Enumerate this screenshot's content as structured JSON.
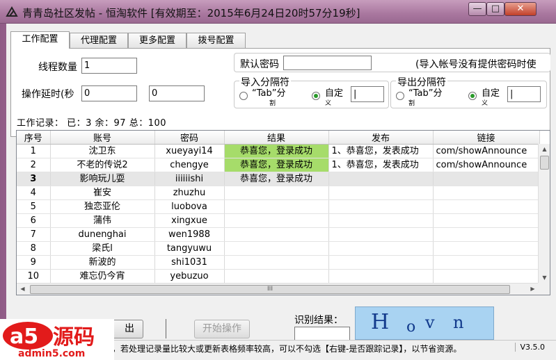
{
  "window": {
    "title": "青青岛社区发帖 - 恒淘软件 [有效期至：2015年6月24日20时57分19秒]",
    "controls": {
      "minimize": "—",
      "maximize": "□",
      "close": "✕"
    }
  },
  "tabs": [
    "工作配置",
    "代理配置",
    "更多配置",
    "拨号配置"
  ],
  "config": {
    "thread_count_label": "线程数量",
    "thread_count_value": "1",
    "delay_label": "操作延时(秒",
    "delay_from": "0",
    "delay_to": "0",
    "default_password_label": "默认密码",
    "default_password_value": "",
    "default_password_hint": "(导入帐号没有提供密码时使",
    "import_sep": {
      "title": "导入分隔符",
      "option_tab": "“Tab”分",
      "option_tab_sub": "割",
      "option_custom": "自定",
      "option_custom_sub": "义",
      "custom_value": "|",
      "selected": "custom"
    },
    "export_sep": {
      "title": "导出分隔符",
      "option_tab": "“Tab”分",
      "option_tab_sub": "割",
      "option_custom": "自定",
      "option_custom_sub": "义",
      "custom_value": "|",
      "selected": "custom"
    }
  },
  "work_record": "工作记录：  已：3  余：97  总：100",
  "grid": {
    "columns": [
      "序号",
      "账号",
      "密码",
      "结果",
      "发布",
      "链接"
    ],
    "rows": [
      {
        "no": "1",
        "account": "沈卫东",
        "password": "xueyayi14",
        "result": "恭喜您，登录成功",
        "publish": "1、恭喜您，发表成功",
        "link": "com/showAnnounce"
      },
      {
        "no": "2",
        "account": "不老的传说2",
        "password": "chengye",
        "result": "恭喜您，登录成功",
        "publish": "1、恭喜您，发表成功",
        "link": "com/showAnnounce"
      },
      {
        "no": "3",
        "account": "影响玩儿耍",
        "password": "iiiiiishi",
        "result": "恭喜您，登录成功",
        "publish": "",
        "link": ""
      },
      {
        "no": "4",
        "account": "崔安",
        "password": "zhuzhu",
        "result": "",
        "publish": "",
        "link": ""
      },
      {
        "no": "5",
        "account": "独恋亚伦",
        "password": "luobova",
        "result": "",
        "publish": "",
        "link": ""
      },
      {
        "no": "6",
        "account": "蒲伟",
        "password": "xingxue",
        "result": "",
        "publish": "",
        "link": ""
      },
      {
        "no": "7",
        "account": "dunenghai",
        "password": "wen1988",
        "result": "",
        "publish": "",
        "link": ""
      },
      {
        "no": "8",
        "account": "梁氏l",
        "password": "tangyuwu",
        "result": "",
        "publish": "",
        "link": ""
      },
      {
        "no": "9",
        "account": "新波的",
        "password": "shi1031",
        "result": "",
        "publish": "",
        "link": ""
      },
      {
        "no": "10",
        "account": "难忘仍今宵",
        "password": "yebuzuo",
        "result": "",
        "publish": "",
        "link": ""
      }
    ],
    "selected_row": 2,
    "success_color": "#a6dc6a",
    "hscroll_grip": "III"
  },
  "buttons": {
    "export": "出",
    "start": "开始操作"
  },
  "captcha": {
    "label": "识别结果：",
    "value": "",
    "chars": [
      "H",
      "o",
      "v",
      "n"
    ]
  },
  "statusbar": {
    "text": "行，若处理记录量比较大或更新表格频率较高，可以不勾选【右键-是否跟踪记录】，以节省资源。",
    "version": "V3.5.0"
  },
  "watermark": {
    "brand": "a5源码",
    "url": "admin5.com"
  }
}
